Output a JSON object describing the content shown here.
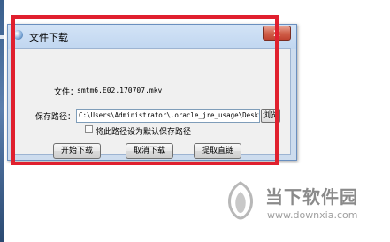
{
  "dialog": {
    "title": "文件下载",
    "close_glyph": "✕",
    "file_label": "文件：",
    "file_name": "smtm6.E02.170707.mkv",
    "path_label": "保存路径：",
    "path_value": "C:\\Users\\Administrator\\.oracle_jre_usage\\Desktop\\魔晶",
    "browse_label": "浏览",
    "default_checkbox_label": "将此路径设为默认保存路径",
    "default_checked": false,
    "buttons": {
      "start": "开始下载",
      "cancel": "取消下载",
      "extract": "提取直链"
    }
  },
  "annotation": {
    "frame_color": "#e0202e"
  },
  "watermark": {
    "brand": "当下软件园",
    "url": "www.downxia.com"
  }
}
